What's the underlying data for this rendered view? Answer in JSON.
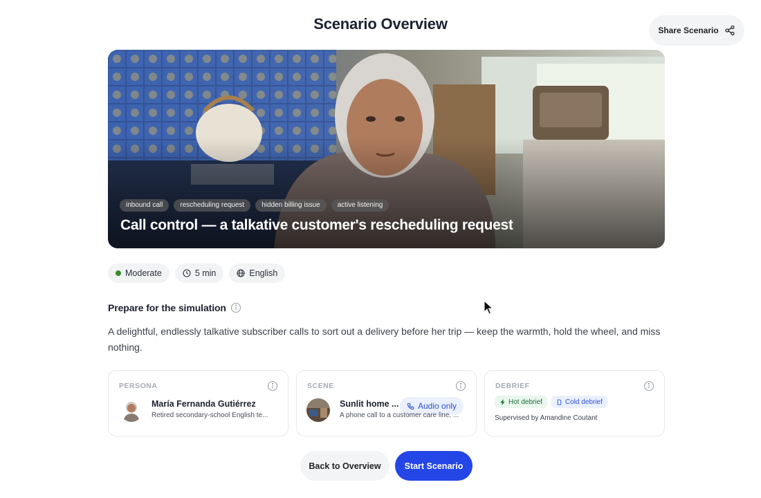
{
  "page": {
    "title": "Scenario Overview"
  },
  "share": {
    "label": "Share Scenario",
    "icon": "share-icon"
  },
  "hero": {
    "tags": [
      "inbound call",
      "rescheduling request",
      "hidden billing issue",
      "active listening"
    ],
    "title": "Call control — a talkative customer's rescheduling request"
  },
  "meta": {
    "difficulty": "Moderate",
    "duration": "5 min",
    "language": "English",
    "difficulty_color": "#3a8a2a"
  },
  "prepare": {
    "title": "Prepare for the simulation",
    "description": "A delightful, endlessly talkative subscriber calls to sort out a delivery before her trip — keep the warmth, hold the wheel, and miss nothing."
  },
  "persona": {
    "label": "PERSONA",
    "name": "María Fernanda Gutiérrez",
    "subtitle": "Retired secondary-school English te..."
  },
  "scene": {
    "label": "SCENE",
    "name": "Sunlit home ...",
    "mode": "Audio only",
    "subtitle": "A phone call to a customer care line, ..."
  },
  "debrief": {
    "label": "DEBRIEF",
    "hot": "Hot debrief",
    "cold": "Cold debrief",
    "supervisor": "Supervised by Amandine Coutant"
  },
  "actions": {
    "back": "Back to Overview",
    "start": "Start Scenario"
  },
  "colors": {
    "primary": "#2446e6",
    "chip_bg": "#f2f3f5"
  }
}
